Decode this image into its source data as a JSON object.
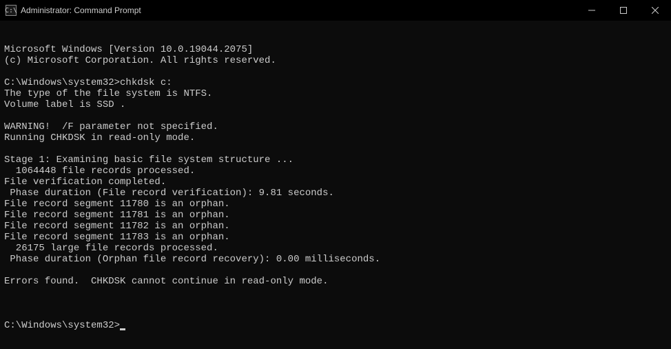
{
  "window": {
    "title": "Administrator: Command Prompt",
    "icon_label": "C:\\"
  },
  "terminal": {
    "lines": [
      "Microsoft Windows [Version 10.0.19044.2075]",
      "(c) Microsoft Corporation. All rights reserved.",
      "",
      "C:\\Windows\\system32>chkdsk c:",
      "The type of the file system is NTFS.",
      "Volume label is SSD .",
      "",
      "WARNING!  /F parameter not specified.",
      "Running CHKDSK in read-only mode.",
      "",
      "Stage 1: Examining basic file system structure ...",
      "  1064448 file records processed.",
      "File verification completed.",
      " Phase duration (File record verification): 9.81 seconds.",
      "File record segment 11780 is an orphan.",
      "File record segment 11781 is an orphan.",
      "File record segment 11782 is an orphan.",
      "File record segment 11783 is an orphan.",
      "  26175 large file records processed.",
      " Phase duration (Orphan file record recovery): 0.00 milliseconds.",
      "",
      "Errors found.  CHKDSK cannot continue in read-only mode.",
      ""
    ],
    "prompt": "C:\\Windows\\system32>"
  }
}
